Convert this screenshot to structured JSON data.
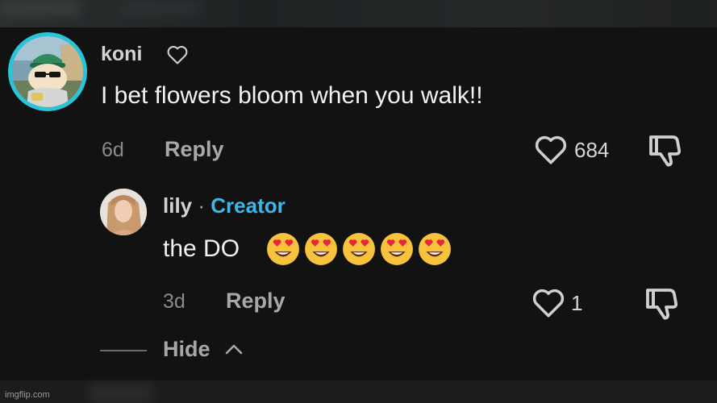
{
  "main_comment": {
    "username": "koni",
    "text": "I bet flowers bloom when you walk!!",
    "time": "6d",
    "reply_label": "Reply",
    "likes": "684"
  },
  "reply_comment": {
    "username": "lily",
    "separator": "·",
    "badge": "Creator",
    "text": "the DO",
    "emoji_count": 5,
    "time": "3d",
    "reply_label": "Reply",
    "likes": "1"
  },
  "thread": {
    "hide_label": "Hide"
  },
  "watermark": "imgflip.com",
  "colors": {
    "background": "#121212",
    "avatar_ring": "#28c4d8",
    "creator_badge": "#3fb7e6"
  },
  "icons": [
    "heart-icon",
    "dislike-icon",
    "chevron-up-icon",
    "heart-eyes-emoji"
  ]
}
